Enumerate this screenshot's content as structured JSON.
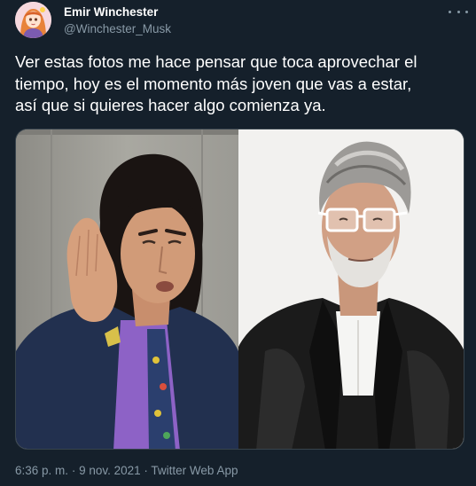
{
  "author": {
    "display_name": "Emir Winchester",
    "handle": "@Winchester_Musk"
  },
  "tweet": {
    "text_lines": [
      "Ver estas fotos me hace pensar que toca aprovechar el",
      "tiempo, hoy es el momento más joven que vas a estar,",
      "así que si quieres hacer algo comienza ya."
    ]
  },
  "meta": {
    "time": "6:36 p. m.",
    "separator": "·",
    "date": "9 nov. 2021",
    "source": "Twitter Web App"
  },
  "icons": {
    "more": "more-options-icon"
  },
  "colors": {
    "background": "#15202b",
    "primary_text": "#ffffff",
    "secondary_text": "#8899a6",
    "border": "#38444d"
  }
}
